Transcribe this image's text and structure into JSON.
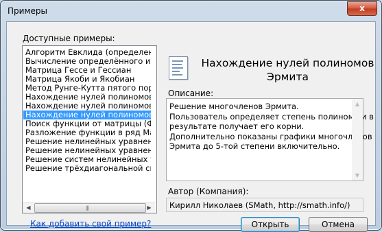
{
  "window": {
    "title": "Примеры",
    "close_glyph": "x"
  },
  "examples_label": "Доступные примеры:",
  "examples": [
    "Алгоритм Евклида (определение НОД",
    "Вычисление определённого интеграл",
    "Матрица Гессе и Гессиан",
    "Матрица Якоби и Якобиан",
    "Метод Рунге-Кутта пятого порядка с а",
    "Нахождение нулей полиномов Лагер",
    "Нахождение нулей полиномов Лежан",
    "Нахождение нулей полиномов Эрмит",
    "Поиск функции от матрицы (Формула",
    "Разложение функции в ряд Маклорен",
    "Решение нелинейных уравнений мето",
    "Решение нелинейных уравнений мето",
    "Решение систем нелинейных уравне",
    "Решение трёхдиагональной системы"
  ],
  "selected_index": 7,
  "example_title": "Нахождение нулей полиномов Эрмита",
  "description_label": "Описание:",
  "description_lines": [
    "Решение многочленов Эрмита.",
    "Пользователь определяет степень полинома и в",
    "результате получает его корни.",
    "Дополнительно показаны графики многочленов",
    "Эрмита до 5-той степени включительно."
  ],
  "author_label": "Автор (Компания):",
  "author_value": "Кирилл Николаев (SMath, http://smath.info/)",
  "add_example_link": "Как добавить свой пример?",
  "open_button": "Открыть",
  "cancel_button": "Отмена"
}
